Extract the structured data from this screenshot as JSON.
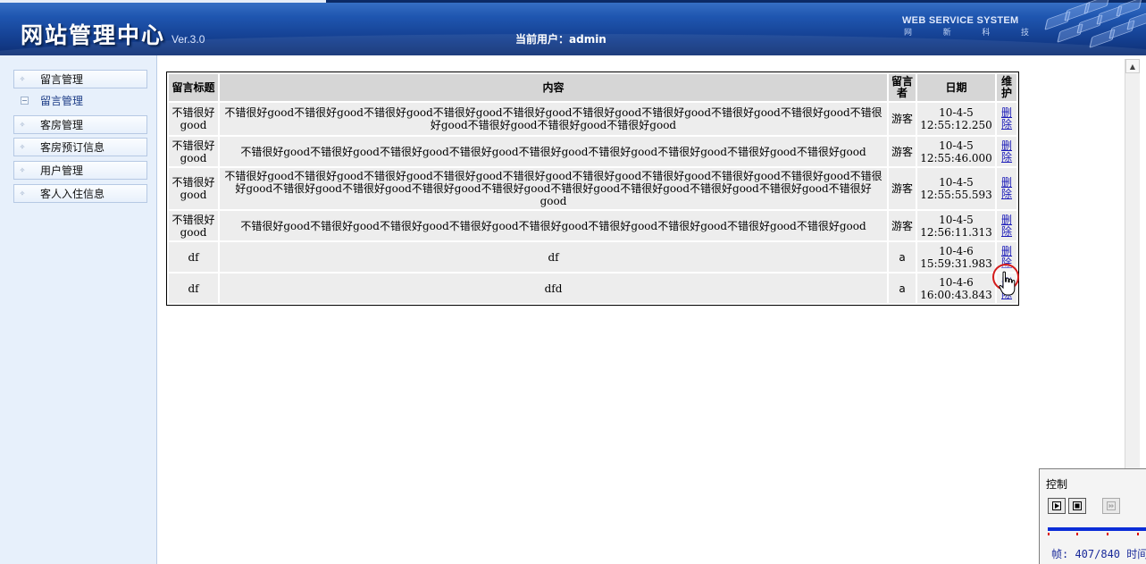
{
  "header": {
    "title": "网站管理中心",
    "version": "Ver.3.0",
    "current_user": "当前用户：admin",
    "brand_en": "WEB SERVICE SYSTEM",
    "brand_cn": [
      "网",
      "新",
      "科",
      "技"
    ]
  },
  "sidebar": {
    "items": [
      {
        "label": "留言管理"
      },
      {
        "label": "留言管理",
        "sub": true
      },
      {
        "label": "客房管理"
      },
      {
        "label": "客房预订信息"
      },
      {
        "label": "用户管理"
      },
      {
        "label": "客人入住信息"
      }
    ]
  },
  "table": {
    "headers": [
      "留言标题",
      "内容",
      "留言者",
      "日期",
      "维护"
    ],
    "rows": [
      {
        "title": "不错很好good",
        "content": "不错很好good不错很好good不错很好good不错很好good不错很好good不错很好good不错很好good不错很好good不错很好good不错很好good不错很好good不错很好good不错很好good",
        "author": "游客",
        "date": "10-4-5 12:55:12.250",
        "action": "删除"
      },
      {
        "title": "不错很好good",
        "content": "不错很好good不错很好good不错很好good不错很好good不错很好good不错很好good不错很好good不错很好good不错很好good",
        "author": "游客",
        "date": "10-4-5 12:55:46.000",
        "action": "删除"
      },
      {
        "title": "不错很好good",
        "content": "不错很好good不错很好good不错很好good不错很好good不错很好good不错很好good不错很好good不错很好good不错很好good不错很好good不错很好good不错很好good不错很好good不错很好good不错很好good不错很好good不错很好good不错很好good不错很好good",
        "author": "游客",
        "date": "10-4-5 12:55:55.593",
        "action": "删除"
      },
      {
        "title": "不错很好good",
        "content": "不错很好good不错很好good不错很好good不错很好good不错很好good不错很好good不错很好good不错很好good不错很好good",
        "author": "游客",
        "date": "10-4-5 12:56:11.313",
        "action": "删除"
      },
      {
        "title": "df",
        "content": "df",
        "author": "a",
        "date": "10-4-6 15:59:31.983",
        "action": "删除"
      },
      {
        "title": "df",
        "content": "dfd",
        "author": "a",
        "date": "10-4-6 16:00:43.843",
        "action": "删除"
      }
    ]
  },
  "control": {
    "title": "控制",
    "frames": "帧: 407/840 时间"
  },
  "colors": {
    "header_blue": "#1f56b0",
    "sidebar_bg": "#e7f0fb",
    "link": "#1a1ab8",
    "click_ring": "#d41c1c"
  }
}
